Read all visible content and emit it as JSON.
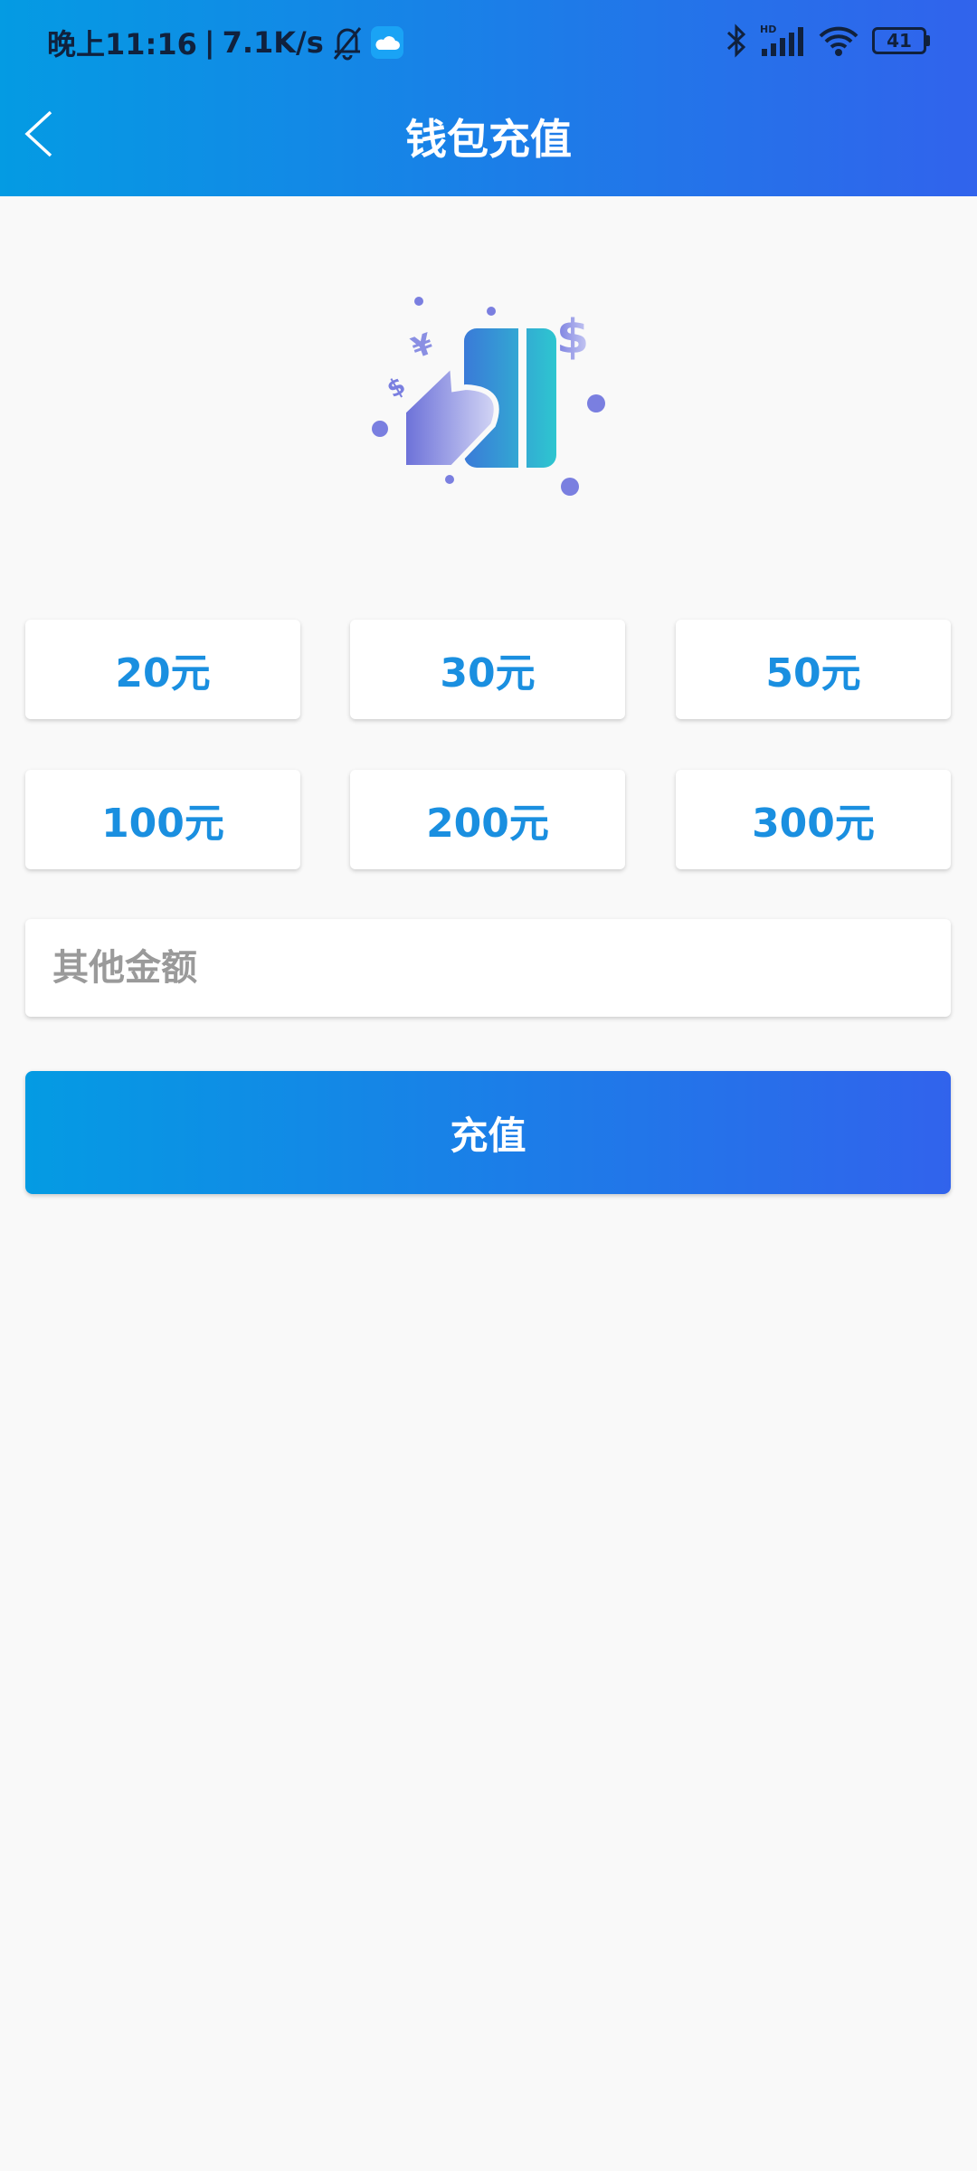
{
  "status_bar": {
    "time": "晚上11:16",
    "separator": "|",
    "net_speed": "7.1K/s",
    "battery": "41",
    "signal_label": "HD"
  },
  "header": {
    "title": "钱包充值"
  },
  "amounts": [
    "20元",
    "30元",
    "50元",
    "100元",
    "200元",
    "300元"
  ],
  "other_amount": {
    "placeholder": "其他金额",
    "value": ""
  },
  "submit_label": "充值",
  "colors": {
    "accent": "#1a8fe0",
    "gradient_start": "#049be3",
    "gradient_end": "#3163ec"
  }
}
